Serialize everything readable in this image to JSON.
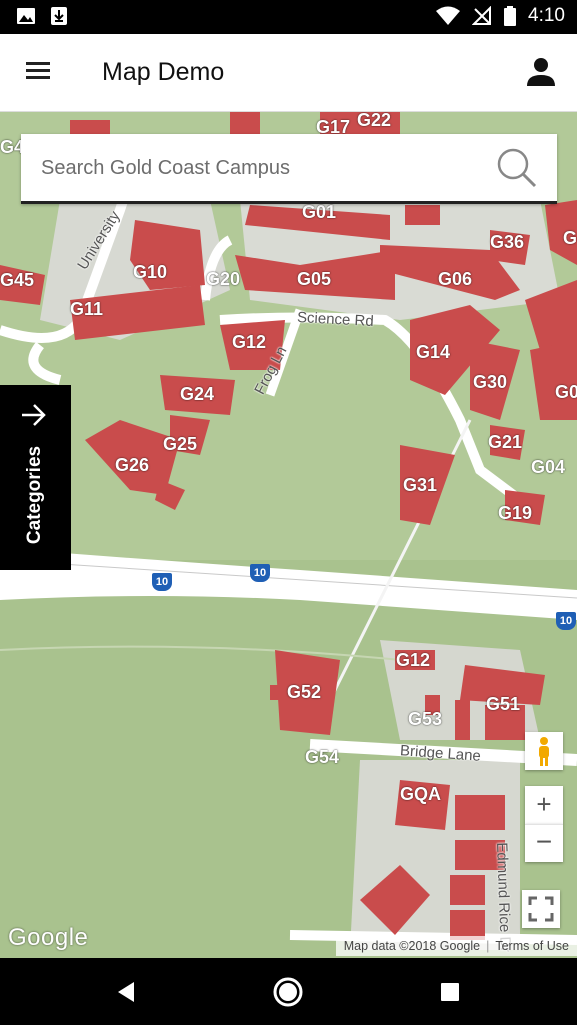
{
  "status_bar": {
    "time": "4:10"
  },
  "app_bar": {
    "title": "Map Demo"
  },
  "search": {
    "placeholder": "Search Gold Coast Campus"
  },
  "categories_label": "Categories",
  "map_controls": {
    "zoom_in": "+",
    "zoom_out": "−"
  },
  "attribution": {
    "map_data": "Map data ©2018 Google",
    "terms": "Terms of Use",
    "logo": "Google"
  },
  "building_labels": [
    "G17",
    "G22",
    "G01",
    "G36",
    "G45",
    "G10",
    "G20",
    "G05",
    "G06",
    "G11",
    "G12",
    "G14",
    "G30",
    "G24",
    "G25",
    "G26",
    "G21",
    "G04",
    "G31",
    "G19",
    "G12",
    "G52",
    "G53",
    "G51",
    "G54",
    "GQA",
    "G4",
    "G",
    "G0"
  ],
  "road_labels": [
    "University",
    "Science Rd",
    "Frog Ln",
    "Bridge Lane",
    "Edmund Rice Dr"
  ],
  "highway_shield": "10",
  "colors": {
    "building": "#c94c4c",
    "grass": "#a9c28e",
    "road": "#ffffff",
    "status_bar": "#000000"
  }
}
